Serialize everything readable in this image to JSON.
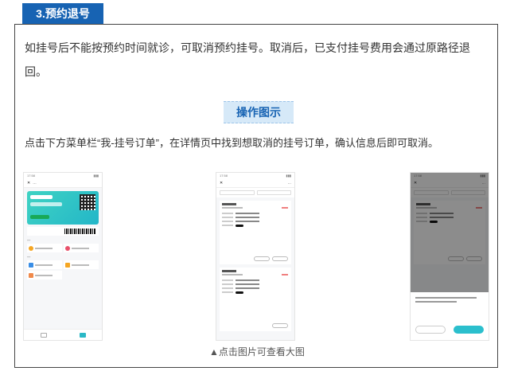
{
  "section": {
    "number_title": "3.预约退号"
  },
  "intro_text": "如挂号后不能按预约时间就诊，可取消预约挂号。取消后，已支付挂号费用会通过原路径退回。",
  "illustration_badge": "操作图示",
  "instruction_text": "点击下方菜单栏“我-挂号订单”，在详情页中找到想取消的挂号订单，确认信息后即可取消。",
  "caption": "▲点击图片可查看大图",
  "colors": {
    "accent": "#1763b3",
    "badge_bg": "#d6e9f8",
    "teal": "#2bb8c6"
  }
}
